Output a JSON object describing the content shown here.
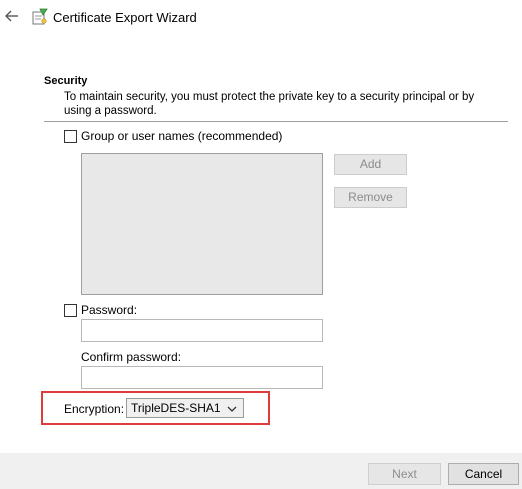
{
  "header": {
    "back_icon": "arrow-left-icon",
    "wizard_icon": "certificate-wizard-icon",
    "title": "Certificate Export Wizard"
  },
  "security": {
    "heading": "Security",
    "description": "To maintain security, you must protect the private key to a security principal or by using a password.",
    "group_checkbox_label": "Group or user names (recommended)",
    "group_checked": false,
    "add_label": "Add",
    "remove_label": "Remove",
    "password_checkbox_label": "Password:",
    "password_checked": false,
    "password_value": "",
    "confirm_label": "Confirm password:",
    "confirm_value": "",
    "encryption_label": "Encryption:",
    "encryption_value": "TripleDES-SHA1"
  },
  "footer": {
    "next_label": "Next",
    "cancel_label": "Cancel"
  },
  "colors": {
    "highlight": "#e03b3b",
    "footer_bg": "#f0f0f0"
  }
}
